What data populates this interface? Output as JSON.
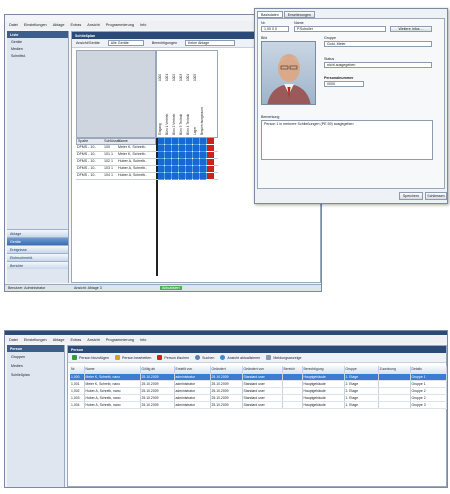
{
  "colors": {
    "accent": "#3c7bd2",
    "selected_cell": "#4ea3e8",
    "warn_cell": "#cc2222",
    "status_ok": "#4caf50",
    "title": "#2a4b78"
  },
  "top": {
    "menu": [
      "Datei",
      "Einstellungen",
      "Ablage",
      "Extras",
      "Ansicht",
      "Programmierung",
      "Info"
    ],
    "sidebar": {
      "header": "Liste",
      "items": [
        "Geräte",
        "Medien",
        "Schnittst."
      ]
    },
    "nav": [
      "Ablage",
      "Geräte",
      "Ereignisse",
      "Einbruchmeld.",
      "Berichte"
    ],
    "window_title": "Schließplan",
    "selectors": {
      "left_label": "Ansicht/Geräte",
      "left_value": "Alle Geräte",
      "right_label": "Berechtigungen",
      "right_value": "Keine Ablage"
    },
    "col_heads": [
      "Spalte",
      "Schlüssel",
      "Name",
      "1000",
      "1001",
      "1002",
      "1003",
      "1004",
      "1005",
      "Eingang",
      "Büro 1 Vertrieb",
      "Büro 2 Vertrieb",
      "Büro 3 Technik",
      "Büro 4 Technik",
      "Lager",
      "Besprechungsraum"
    ],
    "grid_rows": [
      {
        "a": "DFMS - 10..",
        "b": "100",
        "c": "Meier K, Schreib.."
      },
      {
        "a": "DFMS - 10..",
        "b": "101 1",
        "c": "Meier K, Schreib.."
      },
      {
        "a": "DFMS - 10..",
        "b": "102 1",
        "c": "Huber A, Schreib.."
      },
      {
        "a": "DFMS - 10..",
        "b": "103 1",
        "c": "Huber A, Schreib.."
      },
      {
        "a": "DFMS - 10..",
        "b": "104 1",
        "c": "Huber A, Schreib.."
      }
    ],
    "status": {
      "left": "Benutzer: Administrator",
      "mid": "Ansicht: Ablage 3",
      "ok": "Aktualisiert"
    }
  },
  "dialog": {
    "tabs": [
      "Basisdaten",
      "Erweiterungen"
    ],
    "fields": {
      "nr_label": "Nr.",
      "nr_value": "1,00 0 0",
      "name_label": "Name",
      "name_value": "P.Schuller",
      "button": "Weitere Infos ...",
      "bild_label": "Bild",
      "group_label": "Gruppe",
      "group_value": "Gold, Meier",
      "status_label": "Status",
      "status_value": "nicht ausgegeben",
      "pin_label": "Personalnummer",
      "pin_value": "0000",
      "notes_label": "Bemerkung",
      "notes_value": "Person 1 in mehrere Schließungen (PE 59) ausgegeben"
    },
    "buttons": [
      "Speichern",
      "Schliessen"
    ]
  },
  "bottom": {
    "menu": [
      "Datei",
      "Einstellungen",
      "Ablage",
      "Extras",
      "Ansicht",
      "Programmierung",
      "Info"
    ],
    "sidebar": {
      "header": "Person",
      "items": [
        "Gruppen",
        "Medien",
        "Schließplan"
      ]
    },
    "window_title": "Person",
    "toolbar": [
      "Person hinzufügen",
      "Person bearbeiten",
      "Person löschen",
      "Suchen",
      "Ansicht aktualisieren",
      "Meldungsanzeige"
    ],
    "columns": [
      "Nr.",
      "Name",
      "Gültig ab",
      "Erstellt von",
      "Geändert",
      "Geändert von",
      "Bereich",
      "Berechtigung",
      "Gruppe",
      "Zuordnung",
      "Details"
    ],
    "rows": [
      [
        "1,000",
        "Meier K, Schreib, nano",
        "25.10.2009",
        "administrator",
        "25.10.2009",
        "Standard user",
        "",
        "Hauptgebäude",
        "1. Etage",
        "",
        "Gruppe 1"
      ],
      [
        "1,001",
        "Meier K, Schreib, nano",
        "25.10.2009",
        "administrator",
        "25.10.2009",
        "Standard user",
        "",
        "Hauptgebäude",
        "2. Etage",
        "",
        "Gruppe 1"
      ],
      [
        "1,002",
        "Huber A, Schreib, nano",
        "25.10.2009",
        "administrator",
        "25.10.2009",
        "Standard user",
        "",
        "Hauptgebäude",
        "2. Etage",
        "",
        "Gruppe 2"
      ],
      [
        "1,003",
        "Huber A, Schreib, nano",
        "25.10.2009",
        "administrator",
        "25.10.2009",
        "Standard user",
        "",
        "Hauptgebäude",
        "1. Etage",
        "",
        "Gruppe 2"
      ],
      [
        "1,004",
        "Huber A, Schreib, nano",
        "25.10.2009",
        "administrator",
        "25.10.2009",
        "Standard user",
        "",
        "Hauptgebäude",
        "1. Etage",
        "",
        "Gruppe 3"
      ]
    ]
  }
}
